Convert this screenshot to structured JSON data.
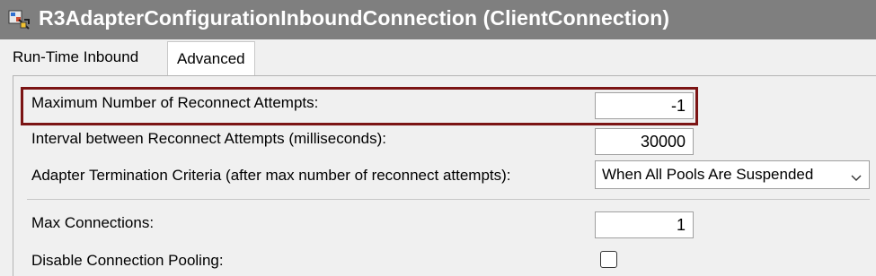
{
  "window": {
    "title": "R3AdapterConfigurationInboundConnection (ClientConnection)",
    "icon": "adapter-config-icon"
  },
  "tabs": [
    {
      "label": "Run-Time Inbound",
      "selected": false
    },
    {
      "label": "Advanced",
      "selected": true
    }
  ],
  "fields": {
    "max_reconnect_attempts": {
      "label": "Maximum Number of Reconnect Attempts:",
      "value": "-1"
    },
    "reconnect_interval": {
      "label": "Interval between Reconnect Attempts (milliseconds):",
      "value": "30000"
    },
    "termination_criteria": {
      "label": "Adapter Termination Criteria (after max number of reconnect attempts):",
      "value": "When All Pools Are Suspended"
    },
    "max_connections": {
      "label": "Max Connections:",
      "value": "1"
    },
    "disable_pooling": {
      "label": "Disable Connection Pooling:",
      "checked": false
    }
  },
  "colors": {
    "titlebar": "#7f7f7f",
    "highlight": "#7b1414",
    "background": "#f0f0f0"
  }
}
